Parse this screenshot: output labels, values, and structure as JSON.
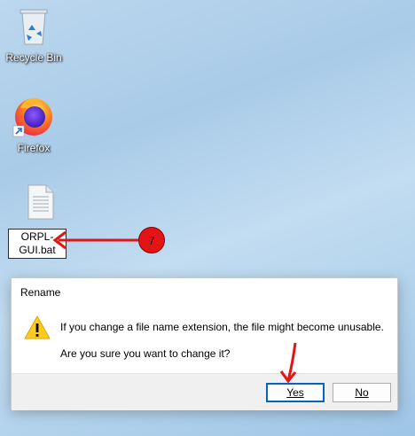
{
  "desktop": {
    "recycle_bin_label": "Recycle Bin",
    "firefox_label": "Firefox",
    "file_rename_line1": "ORPL-",
    "file_rename_line2": "GUI.bat"
  },
  "annotation": {
    "step_number": "7",
    "accent_color": "#e31414"
  },
  "dialog": {
    "title": "Rename",
    "message_line1": "If you change a file name extension, the file might become unusable.",
    "message_line2": "Are you sure you want to change it?",
    "yes_label": "Yes",
    "no_label": "No",
    "icon": "warning-icon"
  }
}
